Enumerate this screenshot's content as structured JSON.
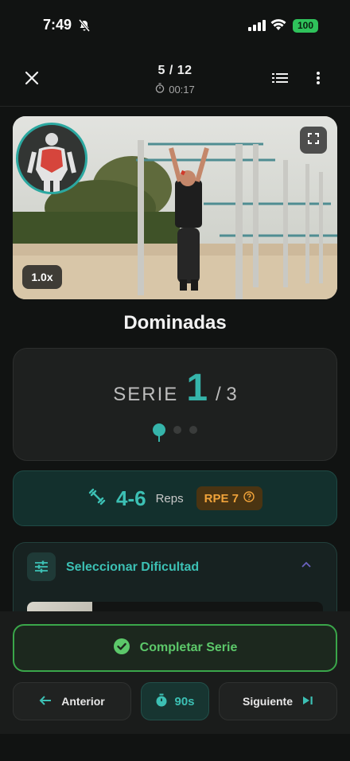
{
  "status_bar": {
    "time": "7:49",
    "battery": "100"
  },
  "header": {
    "progress": "5 / 12",
    "elapsed": "00:17"
  },
  "video": {
    "speed": "1.0x"
  },
  "exercise": {
    "name": "Dominadas"
  },
  "serie": {
    "label": "SERIE",
    "current": "1",
    "total": "/ 3",
    "dots": 3,
    "active_dot": 1
  },
  "reps": {
    "range": "4-6",
    "label": "Reps",
    "rpe": "RPE 7"
  },
  "difficulty": {
    "label": "Seleccionar Dificultad"
  },
  "actions": {
    "complete": "Completar Serie",
    "previous": "Anterior",
    "timer": "90s",
    "next": "Siguiente"
  },
  "colors": {
    "accent": "#35b4aa",
    "success": "#3aa64a",
    "rpe": "#f0a33a"
  },
  "icons": [
    "close-icon",
    "list-icon",
    "more-vertical-icon",
    "stopwatch-icon",
    "fullscreen-icon",
    "dumbbell-icon",
    "help-circle-icon",
    "sliders-icon",
    "chevron-up-icon",
    "check-circle-icon",
    "arrow-left-icon",
    "timer-icon",
    "skip-next-icon"
  ]
}
